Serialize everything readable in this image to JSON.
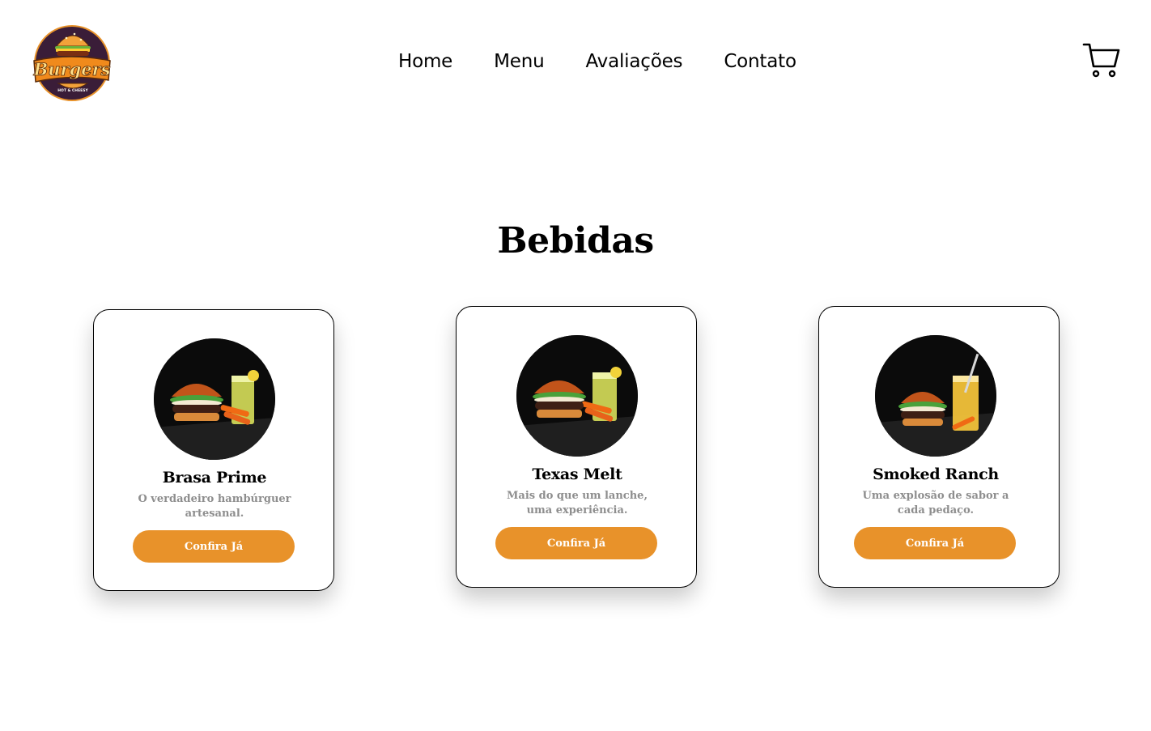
{
  "header": {
    "logo": {
      "brand_text": "Burgers",
      "tagline": "HOT & CHEESY",
      "icon": "burger-logo"
    },
    "nav": [
      {
        "label": "Home"
      },
      {
        "label": "Menu"
      },
      {
        "label": "Avaliações"
      },
      {
        "label": "Contato"
      }
    ],
    "cart_icon": "shopping-cart-icon"
  },
  "section": {
    "title": "Bebidas"
  },
  "cards": [
    {
      "title": "Brasa Prime",
      "description": "O verdadeiro hambúrguer artesanal.",
      "button_label": "Confira Já",
      "image": "burger-with-drink-photo"
    },
    {
      "title": "Texas Melt",
      "description": "Mais do que um lanche, uma experiência.",
      "button_label": "Confira Já",
      "image": "burger-with-drink-photo"
    },
    {
      "title": "Smoked Ranch",
      "description": "Uma explosão de sabor a cada pedaço.",
      "button_label": "Confira Já",
      "image": "burger-with-drink-photo"
    }
  ],
  "colors": {
    "accent": "#e8922a",
    "text": "#000000",
    "muted_text": "#8e8e8e",
    "background": "#ffffff",
    "logo_dark": "#3a1d38"
  }
}
